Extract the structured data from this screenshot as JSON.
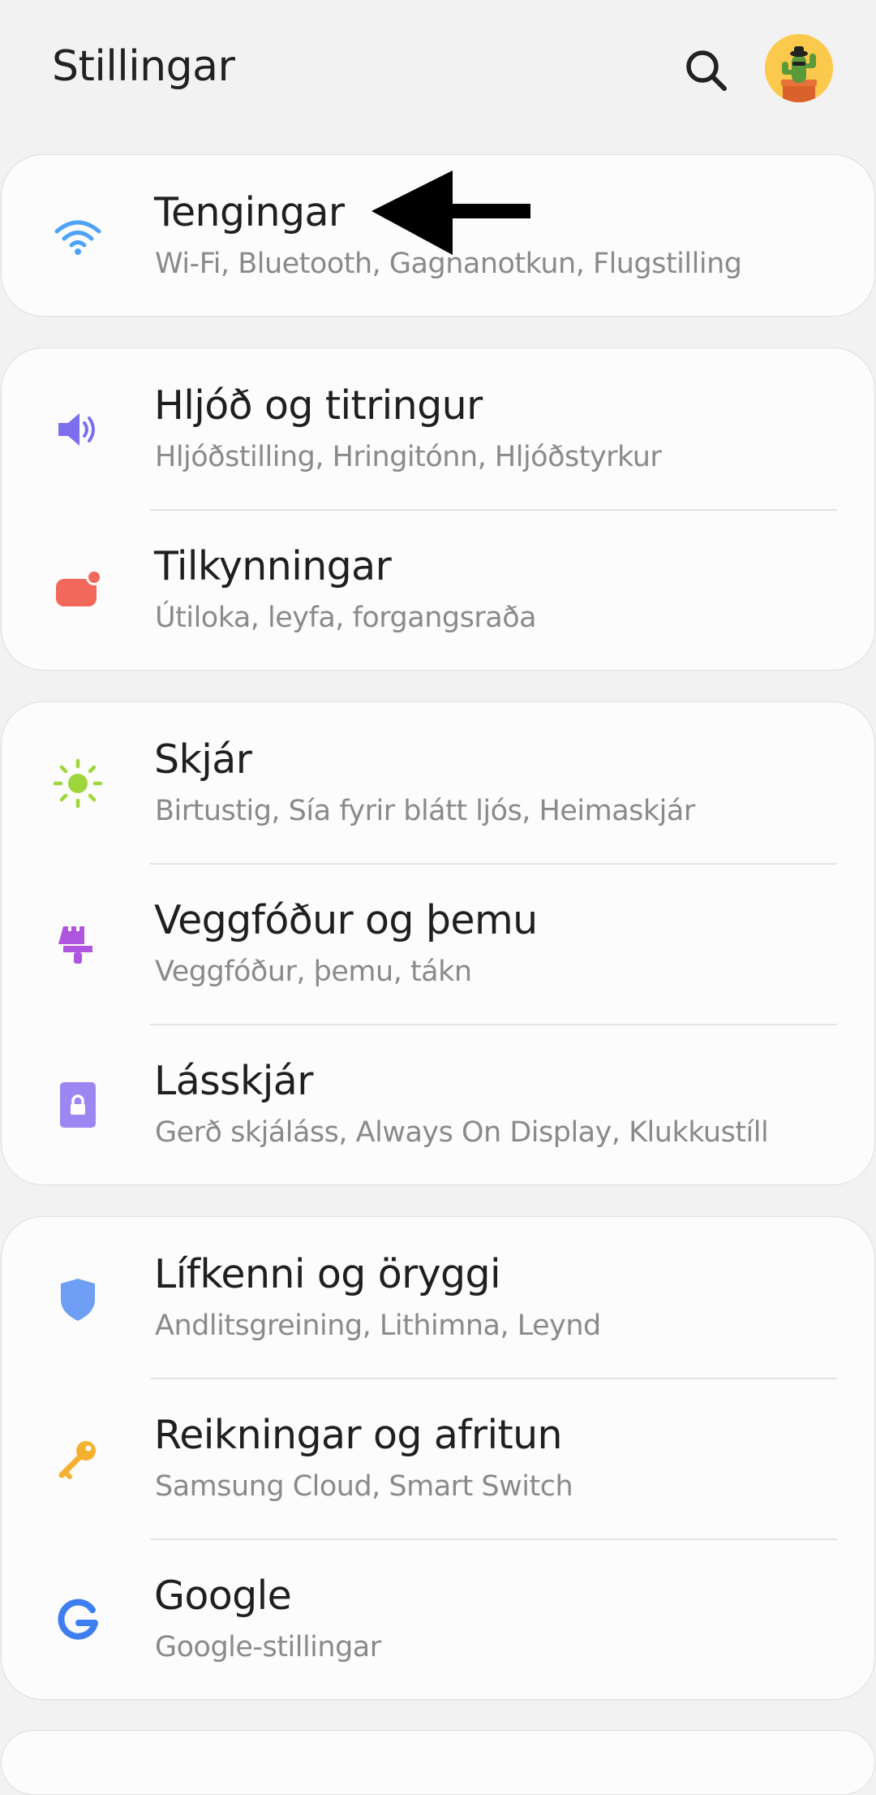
{
  "header": {
    "title": "Stillingar"
  },
  "cards": [
    {
      "rows": [
        {
          "title": "Tengingar",
          "subtitle": "Wi-Fi, Bluetooth, Gagnanotkun, Flugstilling"
        }
      ]
    },
    {
      "rows": [
        {
          "title": "Hljóð og titringur",
          "subtitle": "Hljóðstilling, Hringitónn, Hljóðstyrkur"
        },
        {
          "title": "Tilkynningar",
          "subtitle": "Útiloka, leyfa, forgangsraða"
        }
      ]
    },
    {
      "rows": [
        {
          "title": "Skjár",
          "subtitle": "Birtustig, Sía fyrir blátt ljós, Heimaskjár"
        },
        {
          "title": "Veggfóður og þemu",
          "subtitle": "Veggfóður, þemu, tákn"
        },
        {
          "title": "Lásskjár",
          "subtitle": "Gerð skjáláss, Always On Display, Klukkustíll"
        }
      ]
    },
    {
      "rows": [
        {
          "title": "Lífkenni og öryggi",
          "subtitle": "Andlitsgreining, Lithimna, Leynd"
        },
        {
          "title": "Reikningar og afritun",
          "subtitle": "Samsung Cloud, Smart Switch"
        },
        {
          "title": "Google",
          "subtitle": "Google-stillingar"
        }
      ]
    }
  ],
  "icons": {
    "search": "search-icon",
    "avatar": "cactus-avatar-icon",
    "connections": "wifi-icon",
    "sound": "speaker-icon",
    "notifications": "notification-icon",
    "display": "brightness-icon",
    "wallpaper": "paintbrush-icon",
    "lockscreen": "lock-icon",
    "biometrics": "shield-icon",
    "accounts": "key-icon",
    "google": "google-icon",
    "annotation": "arrow-left-icon"
  },
  "colors": {
    "background": "#f2f2f2",
    "card": "#fcfcfc",
    "wifi": "#4fa3f7",
    "sound": "#7b6ff0",
    "notifications": "#f2695c",
    "display": "#9fd63c",
    "wallpaper": "#b055e0",
    "lockscreen": "#9b86f2",
    "biometrics": "#6f9ff5",
    "accounts": "#f5b12e",
    "google": "#3d7ff0"
  }
}
